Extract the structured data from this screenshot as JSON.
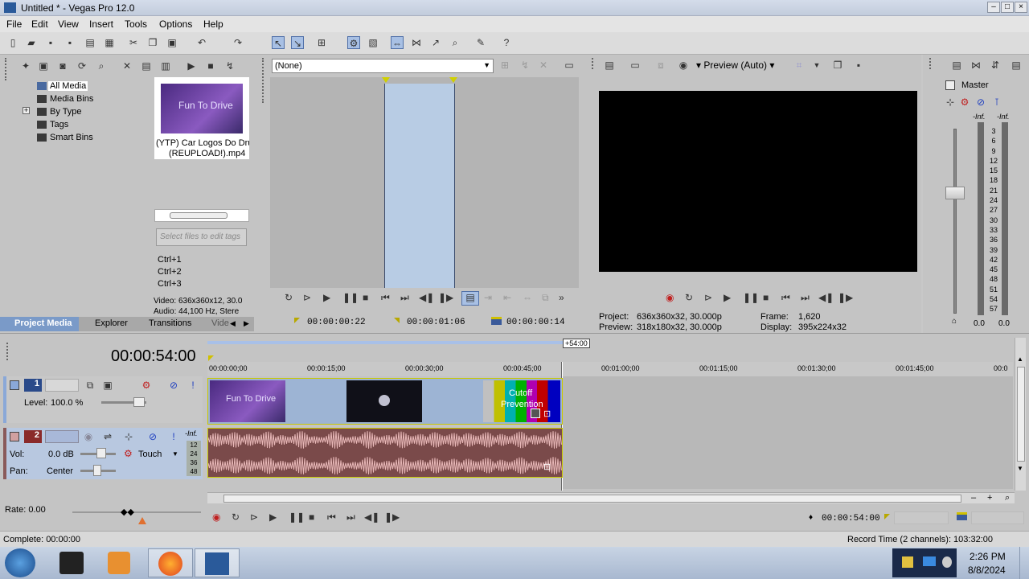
{
  "window": {
    "title": "Untitled * - Vegas Pro 12.0"
  },
  "menu": [
    "File",
    "Edit",
    "View",
    "Insert",
    "Tools",
    "Options",
    "Help"
  ],
  "tree": {
    "items": [
      "All Media",
      "Media Bins",
      "By Type",
      "Tags",
      "Smart Bins"
    ]
  },
  "media": {
    "file_line1": "(YTP) Car Logos Do Drug",
    "file_line2": "(REUPLOAD!).mp4",
    "thumb_text": "Fun To Drive",
    "tag_placeholder": "Select files to edit tags",
    "shortcuts": [
      "Ctrl+1",
      "Ctrl+2",
      "Ctrl+3"
    ],
    "info_video": "Video: 636x360x12, 30.0",
    "info_audio": "Audio: 44,100 Hz, Stere"
  },
  "tabs": [
    "Project Media",
    "Explorer",
    "Transitions",
    "Vide"
  ],
  "trimmer": {
    "dropdown": "(None)",
    "tc_in": "00:00:00:22",
    "tc_out": "00:00:01:06",
    "tc_len": "00:00:00:14"
  },
  "preview": {
    "mode": "Preview (Auto)",
    "project_label": "Project:",
    "project_value": "636x360x32, 30.000p",
    "preview_label": "Preview:",
    "preview_value": "318x180x32, 30.000p",
    "frame_label": "Frame:",
    "frame_value": "1,620",
    "display_label": "Display:",
    "display_value": "395x224x32"
  },
  "master": {
    "label": "Master",
    "inf_left": "-Inf.",
    "inf_right": "-Inf.",
    "scale": [
      "3",
      "6",
      "9",
      "12",
      "15",
      "18",
      "21",
      "24",
      "27",
      "30",
      "33",
      "36",
      "39",
      "42",
      "45",
      "48",
      "51",
      "54",
      "57"
    ],
    "val_left": "0.0",
    "val_right": "0.0"
  },
  "timeline": {
    "cursor": "00:00:54:00",
    "marker": "+54:00",
    "ruler": [
      "00:00:00;00",
      "00:00:15;00",
      "00:00:30;00",
      "00:00:45;00",
      "00:01:00;00",
      "00:01:15;00",
      "00:01:30;00",
      "00:01:45;00",
      "00:0"
    ],
    "end_tc": "00:00:54:00",
    "clip3_line1": "Cutoff",
    "clip3_line2": "Prevention"
  },
  "track1": {
    "num": "1",
    "level_label": "Level:",
    "level_value": "100.0 %"
  },
  "track2": {
    "num": "2",
    "vol_label": "Vol:",
    "vol_value": "0.0 dB",
    "pan_label": "Pan:",
    "pan_value": "Center",
    "mode": "Touch",
    "inf": "-Inf.",
    "meter": [
      "12",
      "24",
      "36",
      "48"
    ]
  },
  "bottom": {
    "rate": "Rate: 0.00",
    "complete": "Complete: 00:00:00",
    "record": "Record Time (2 channels): 103:32:00"
  },
  "taskbar": {
    "time": "2:26 PM",
    "date": "8/8/2024"
  }
}
